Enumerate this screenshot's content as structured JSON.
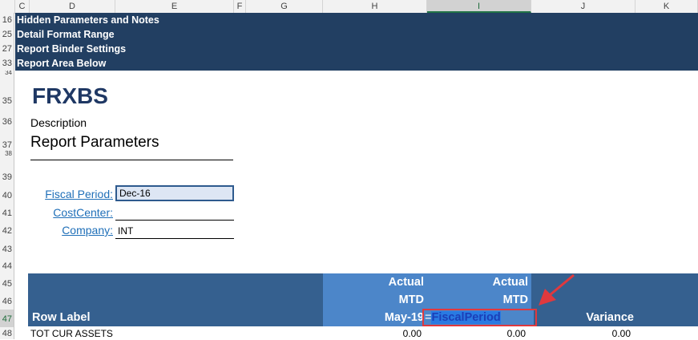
{
  "columns": [
    "C",
    "D",
    "E",
    "F",
    "G",
    "H",
    "I",
    "J",
    "K"
  ],
  "selected_column": "I",
  "banner_rows": [
    {
      "row": "16",
      "text": "Hidden Parameters and Notes"
    },
    {
      "row": "25",
      "text": "Detail Format Range"
    },
    {
      "row": "27",
      "text": "Report Binder Settings"
    },
    {
      "row": "33",
      "text": "Report Area Below"
    }
  ],
  "row_numbers": [
    "34",
    "35",
    "36",
    "37",
    "38",
    "39",
    "40",
    "41",
    "42",
    "43",
    "44",
    "45",
    "46",
    "47",
    "48"
  ],
  "selected_row": "47",
  "report": {
    "title": "FRXBS",
    "description": "Description",
    "params_heading": "Report Parameters"
  },
  "parameters": [
    {
      "label": "Fiscal Period:",
      "value": "Dec-16"
    },
    {
      "label": "CostCenter:",
      "value": ""
    },
    {
      "label": "Company:",
      "value": "INT"
    }
  ],
  "table_header": {
    "row_label": "Row Label",
    "col_h": {
      "line1": "Actual",
      "line2": "MTD",
      "line3": "May-19"
    },
    "col_i": {
      "line1": "Actual",
      "line2": "MTD"
    },
    "variance": "Variance"
  },
  "formula": {
    "eq": "=",
    "name": "FiscalPeriod"
  },
  "data_row": {
    "label": "TOT CUR ASSETS",
    "h": "0.00",
    "i": "0.00",
    "j": "0.00"
  },
  "colors": {
    "banner": "#223f62",
    "header_dark": "#35608f",
    "header_light": "#4c86c9",
    "annotation": "#e0393e"
  }
}
